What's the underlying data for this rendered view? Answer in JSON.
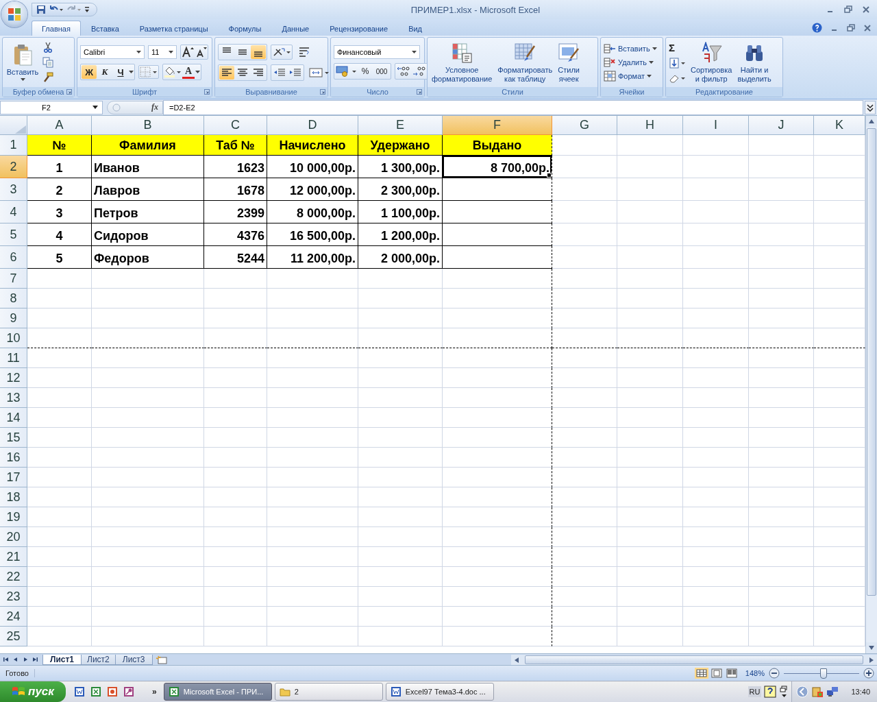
{
  "window": {
    "title": "ПРИМЕР1.xlsx - Microsoft Excel"
  },
  "tabs": [
    {
      "label": "Главная",
      "selected": true
    },
    {
      "label": "Вставка",
      "selected": false
    },
    {
      "label": "Разметка страницы",
      "selected": false
    },
    {
      "label": "Формулы",
      "selected": false
    },
    {
      "label": "Данные",
      "selected": false
    },
    {
      "label": "Рецензирование",
      "selected": false
    },
    {
      "label": "Вид",
      "selected": false
    }
  ],
  "ribbon": {
    "clipboard": {
      "paste_label": "Вставить",
      "title": "Буфер обмена"
    },
    "font": {
      "font_name": "Calibri",
      "font_size": "11",
      "toggles": [
        {
          "label": "Ж",
          "active": true
        },
        {
          "label": "К",
          "active": false
        },
        {
          "label": "Ч",
          "active": false
        }
      ],
      "color_label": "A",
      "title": "Шрифт"
    },
    "alignment": {
      "vertical": [
        {
          "active": false
        },
        {
          "active": false
        },
        {
          "active": true
        }
      ],
      "horizontal": [
        {
          "active": true
        },
        {
          "active": false
        },
        {
          "active": false
        }
      ],
      "title": "Выравнивание"
    },
    "number": {
      "format": "Финансовый",
      "percent": "%",
      "thousands": "000",
      "title": "Число"
    },
    "styles": {
      "buttons": [
        {
          "label": "Условное\nформатирование",
          "kind": "conditional"
        },
        {
          "label": "Форматировать\nкак таблицу",
          "kind": "table"
        },
        {
          "label": "Стили\nячеек",
          "kind": "cellstyle"
        }
      ],
      "title": "Стили"
    },
    "cells": {
      "buttons": [
        {
          "label": "Вставить",
          "kind": "insert"
        },
        {
          "label": "Удалить",
          "kind": "delete"
        },
        {
          "label": "Формат",
          "kind": "format"
        }
      ],
      "title": "Ячейки"
    },
    "editing": {
      "sum": "Σ",
      "buttons": [
        {
          "label": "Сортировка\nи фильтр",
          "kind": "sort"
        },
        {
          "label": "Найти и\nвыделить",
          "kind": "find"
        }
      ],
      "title": "Редактирование"
    }
  },
  "formula_bar": {
    "name_box": "F2",
    "fx": "fx",
    "formula": "=D2-E2"
  },
  "sheet": {
    "columns": [
      {
        "label": "A",
        "selected": false
      },
      {
        "label": "B",
        "selected": false
      },
      {
        "label": "C",
        "selected": false
      },
      {
        "label": "D",
        "selected": false
      },
      {
        "label": "E",
        "selected": false
      },
      {
        "label": "F",
        "selected": true
      },
      {
        "label": "G",
        "selected": false
      },
      {
        "label": "H",
        "selected": false
      },
      {
        "label": "I",
        "selected": false
      },
      {
        "label": "J",
        "selected": false
      },
      {
        "label": "K",
        "selected": false
      }
    ],
    "rows": [
      {
        "header": "1",
        "selected": false,
        "kind": "header",
        "cells": [
          "№",
          "Фамилия",
          "Таб №",
          "Начислено",
          "Удержано",
          "Выдано"
        ]
      },
      {
        "header": "2",
        "selected": true,
        "kind": "data",
        "cells": [
          "1",
          "Иванов",
          "1623",
          "10 000,00р.",
          "1 300,00р.",
          "8 700,00р."
        ]
      },
      {
        "header": "3",
        "selected": false,
        "kind": "data",
        "cells": [
          "2",
          "Лавров",
          "1678",
          "12 000,00р.",
          "2 300,00р."
        ]
      },
      {
        "header": "4",
        "selected": false,
        "kind": "data",
        "cells": [
          "3",
          "Петров",
          "2399",
          "8 000,00р.",
          "1 100,00р."
        ]
      },
      {
        "header": "5",
        "selected": false,
        "kind": "data",
        "cells": [
          "4",
          "Сидоров",
          "4376",
          "16 500,00р.",
          "1 200,00р."
        ]
      },
      {
        "header": "6",
        "selected": false,
        "kind": "data",
        "cells": [
          "5",
          "Федоров",
          "5244",
          "11 200,00р.",
          "2 000,00р."
        ]
      },
      {
        "header": "7",
        "selected": false
      },
      {
        "header": "8",
        "selected": false
      },
      {
        "header": "9",
        "selected": false
      },
      {
        "header": "10",
        "selected": false
      },
      {
        "header": "11",
        "selected": false
      },
      {
        "header": "12",
        "selected": false
      },
      {
        "header": "13",
        "selected": false
      },
      {
        "header": "14",
        "selected": false
      },
      {
        "header": "15",
        "selected": false
      },
      {
        "header": "16",
        "selected": false
      },
      {
        "header": "17",
        "selected": false
      },
      {
        "header": "18",
        "selected": false
      },
      {
        "header": "19",
        "selected": false
      },
      {
        "header": "20",
        "selected": false
      },
      {
        "header": "21",
        "selected": false
      },
      {
        "header": "22",
        "selected": false
      },
      {
        "header": "23",
        "selected": false
      },
      {
        "header": "24",
        "selected": false
      },
      {
        "header": "25",
        "selected": false
      }
    ]
  },
  "sheet_tabs": [
    {
      "label": "Лист1",
      "selected": true
    },
    {
      "label": "Лист2",
      "selected": false
    },
    {
      "label": "Лист3",
      "selected": false
    }
  ],
  "status_bar": {
    "text": "Готово",
    "views": [
      {
        "selected": true
      },
      {
        "selected": false
      },
      {
        "selected": false
      }
    ],
    "zoom": "148%",
    "zoom_slider": {
      "level": 0.52
    }
  },
  "taskbar": {
    "start": "пуск",
    "more": "»",
    "tasks": [
      {
        "label": "Microsoft Excel - ПРИ...",
        "selected": true,
        "kind": "excel"
      },
      {
        "label": "2",
        "selected": false,
        "kind": "folder"
      },
      {
        "label": "Excel97 Тема3-4.doc ...",
        "selected": false,
        "kind": "word"
      }
    ],
    "language": "RU",
    "clock": "13:40"
  }
}
